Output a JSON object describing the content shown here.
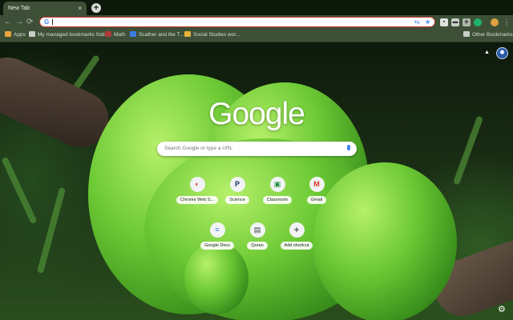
{
  "tab": {
    "title": "New Tab",
    "close": "×"
  },
  "new_tab_button": "+",
  "toolbar": {
    "back": "←",
    "forward": "→",
    "reload": "⟳",
    "omnibox_g": "G"
  },
  "bookmarks": [
    {
      "label": "Apps",
      "icon": "apps-grid-icon",
      "color": "#e8a33a"
    },
    {
      "label": "My managed bookmarks folder",
      "icon": "folder-icon",
      "color": "#c7cdc4"
    },
    {
      "label": "Math",
      "icon": "bookmark-favicon-icon",
      "color": "#b03a3a"
    },
    {
      "label": "Scather and the T...",
      "icon": "docs-favicon-icon",
      "color": "#3b7de1"
    },
    {
      "label": "Social Studies wor...",
      "icon": "hand-favicon-icon",
      "color": "#e7b23a"
    }
  ],
  "other_bookmarks": "Other Bookmarks",
  "ntp": {
    "logo": "Google",
    "search_placeholder": "Search Google or type a URL",
    "shortcuts": [
      {
        "label": "Chrome Web S...",
        "icon": "chrome-icon",
        "glyph": "◐",
        "color": "#db4437"
      },
      {
        "label": "Science",
        "icon": "pearson-icon",
        "glyph": "P",
        "color": "#1a2b5c"
      },
      {
        "label": "Classroom",
        "icon": "classroom-icon",
        "glyph": "▣",
        "color": "#1e8e3e"
      },
      {
        "label": "Gmail",
        "icon": "gmail-icon",
        "glyph": "M",
        "color": "#d93025"
      },
      {
        "label": "Google Docs",
        "icon": "docs-icon",
        "glyph": "≡",
        "color": "#4285f4"
      },
      {
        "label": "Quran",
        "icon": "quran-icon",
        "glyph": "▤",
        "color": "#3c4043"
      },
      {
        "label": "Add shortcut",
        "icon": "plus-icon",
        "glyph": "+",
        "color": "#202124"
      }
    ]
  }
}
